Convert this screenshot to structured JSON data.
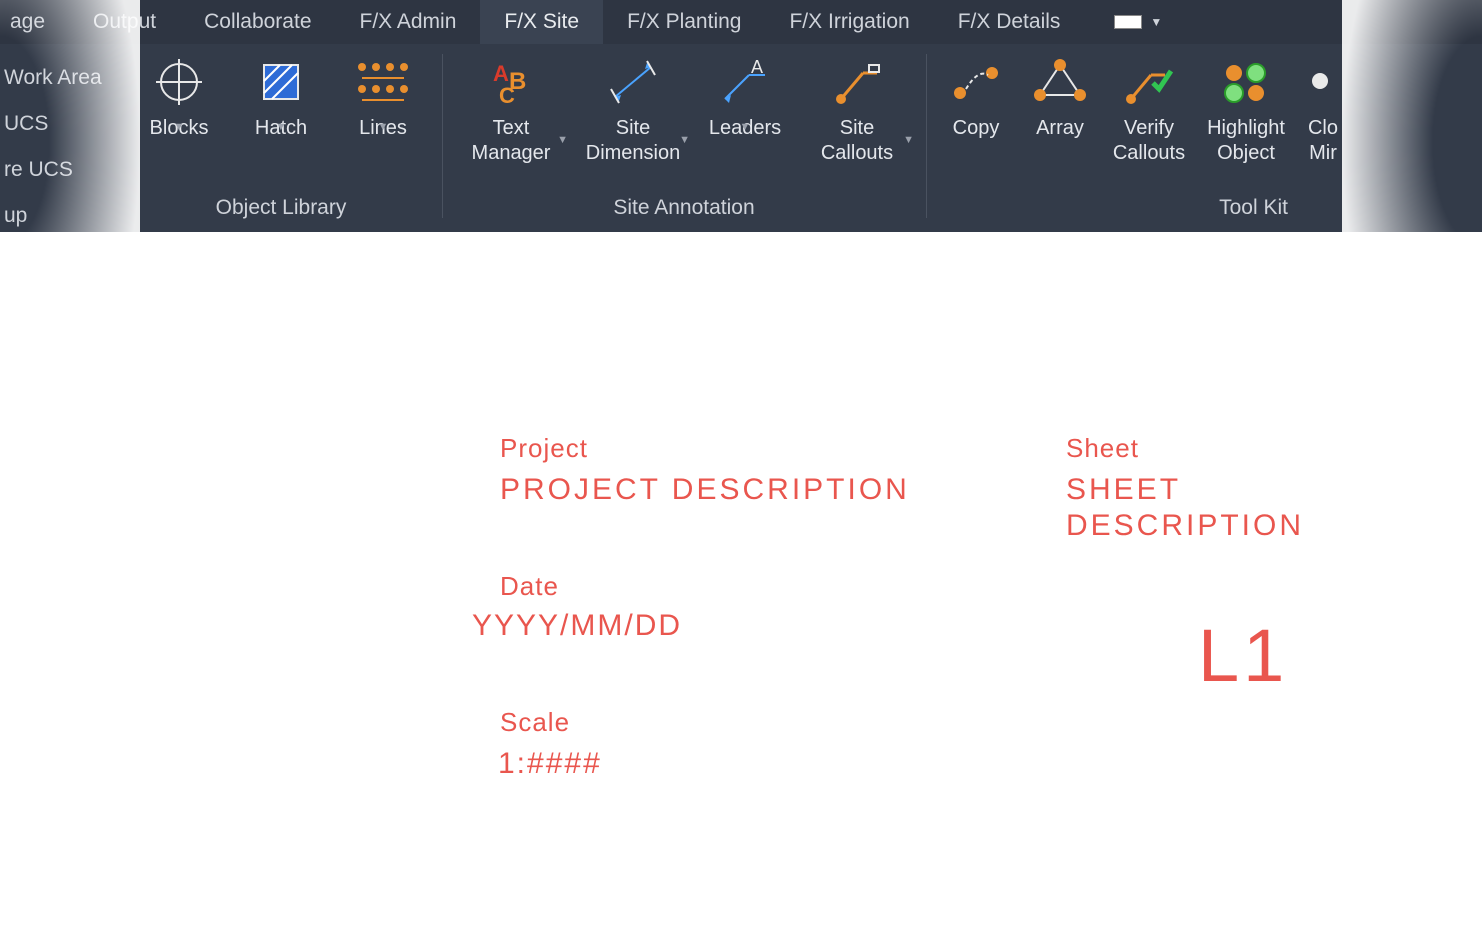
{
  "tabs": {
    "t0": "age",
    "t1": "Output",
    "t2": "Collaborate",
    "t3": "F/X Admin",
    "t4": "F/X Site",
    "t5": "F/X Planting",
    "t6": "F/X Irrigation",
    "t7": "F/X Details"
  },
  "side": {
    "s0": "Work Area",
    "s1": "UCS",
    "s2": "re UCS",
    "s3": "up"
  },
  "panels": {
    "object_library": {
      "title": "Object Library",
      "blocks": "Blocks",
      "hatch": "Hatch",
      "lines": "Lines"
    },
    "site_annotation": {
      "title": "Site Annotation",
      "text_manager1": "Text",
      "text_manager2": "Manager",
      "site_dim1": "Site",
      "site_dim2": "Dimension",
      "leaders": "Leaders",
      "callouts1": "Site",
      "callouts2": "Callouts"
    },
    "toolkit": {
      "title": "Tool Kit",
      "copy": "Copy",
      "array": "Array",
      "verify1": "Verify",
      "verify2": "Callouts",
      "highlight1": "Highlight",
      "highlight2": "Object",
      "close1": "Clo",
      "close2": "Mir"
    }
  },
  "titleblock": {
    "project_label": "Project",
    "project_value": "PROJECT DESCRIPTION",
    "date_label": "Date",
    "date_value": "YYYY/MM/DD",
    "scale_label": "Scale",
    "scale_value": "1:####",
    "sheet_label": "Sheet",
    "sheet_value1": "SHEET",
    "sheet_value2": "DESCRIPTION",
    "sheet_number": "L1"
  }
}
